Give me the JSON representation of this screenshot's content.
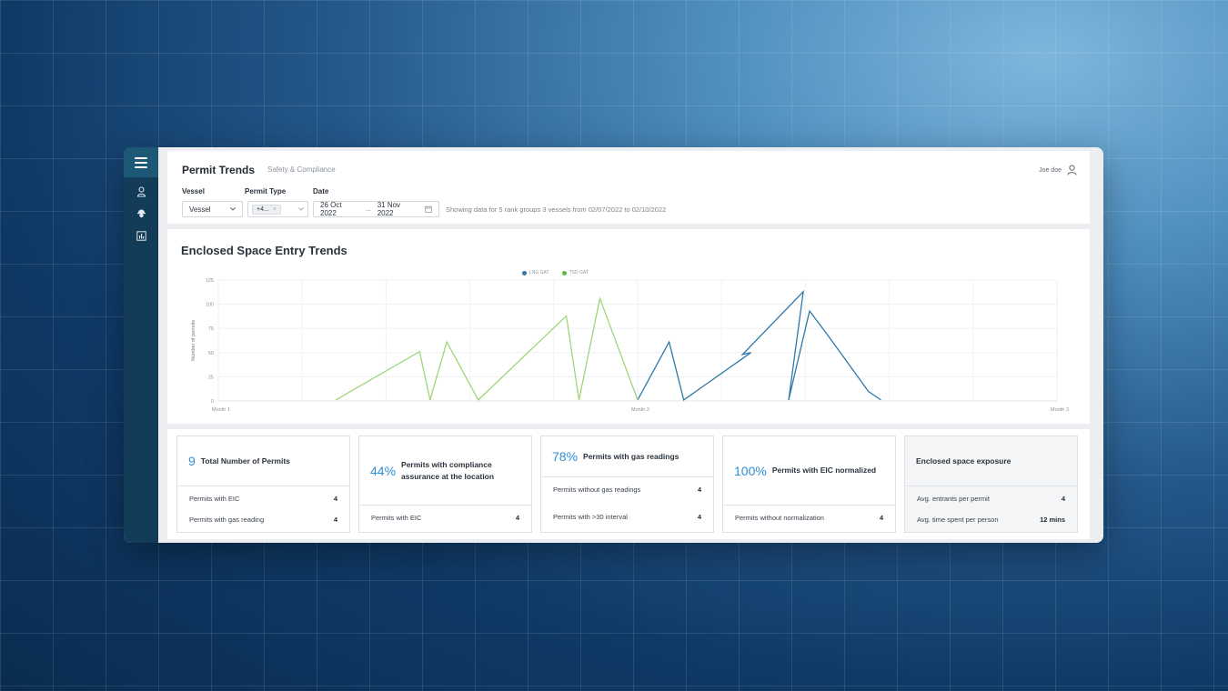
{
  "header": {
    "title": "Permit Trends",
    "subtitle": "Safety & Compliance",
    "user_name": "Joe doe"
  },
  "filters": {
    "vessel_label": "Vessel",
    "vessel_value": "Vessel",
    "permit_type_label": "Permit Type",
    "permit_type_chip": "+4...",
    "date_label": "Date",
    "date_from": "26 Oct 2022",
    "date_arrow": "→",
    "date_to": "31 Nov 2022",
    "hint": "Showing data for 5 rank groups 3 vessels from 02/07/2022 to  02/10/2022"
  },
  "colors": {
    "series_blue": "#2f78a8",
    "series_green": "#9fd67a",
    "accent": "#2e8fd4",
    "sidebar": "#123c57"
  },
  "chart_data": {
    "type": "line",
    "title": "Enclosed Space Entry Trends",
    "ylabel": "Number of permits",
    "xlabel": "",
    "ylim": [
      0,
      125
    ],
    "yticks": [
      "125",
      "100",
      "75",
      "50",
      "25",
      "0"
    ],
    "xticks": [
      "Month 1",
      "Month 2",
      "Month 3"
    ],
    "xlim": [
      0,
      20
    ],
    "legend_position": "top",
    "grid": true,
    "series": [
      {
        "name": "LNG GAT",
        "color": "#2f78a8",
        "x": [
          10.0,
          10.75,
          11.1,
          12.7,
          12.5,
          13.95,
          13.6,
          14.1,
          14.5,
          15.0,
          15.5,
          15.8
        ],
        "y": [
          1,
          61,
          1,
          50,
          48,
          113,
          1,
          93,
          70,
          40,
          10,
          1
        ]
      },
      {
        "name": "TSD GAT",
        "color": "#9fd67a",
        "x": [
          2.8,
          4.8,
          5.05,
          5.45,
          6.2,
          8.3,
          8.6,
          9.1,
          10.0
        ],
        "y": [
          1,
          51,
          1,
          61,
          1,
          88,
          1,
          106,
          1
        ]
      }
    ]
  },
  "stats": [
    {
      "value": "9",
      "title": "Total Number of Permits",
      "rows": [
        {
          "label": "Permits with EIC",
          "value": "4"
        },
        {
          "label": "Permits with gas reading",
          "value": "4"
        }
      ]
    },
    {
      "value": "44%",
      "title": "Permits with compliance assurance at the location",
      "rows": [
        {
          "label": "Permits with EIC",
          "value": "4"
        }
      ]
    },
    {
      "value": "78%",
      "title": "Permits with gas readings",
      "rows": [
        {
          "label": "Permits without gas readings",
          "value": "4"
        },
        {
          "label": "Permits with >30 interval",
          "value": "4"
        }
      ]
    },
    {
      "value": "100%",
      "title": "Permits with EIC normalized",
      "rows": [
        {
          "label": "Permits without normalization",
          "value": "4"
        }
      ]
    },
    {
      "value": "",
      "title": "Enclosed space exposure",
      "rows": [
        {
          "label": "Avg. entrants per permit",
          "value": "4"
        },
        {
          "label": "Avg. time spent per person",
          "value": "12 mins"
        }
      ]
    }
  ]
}
